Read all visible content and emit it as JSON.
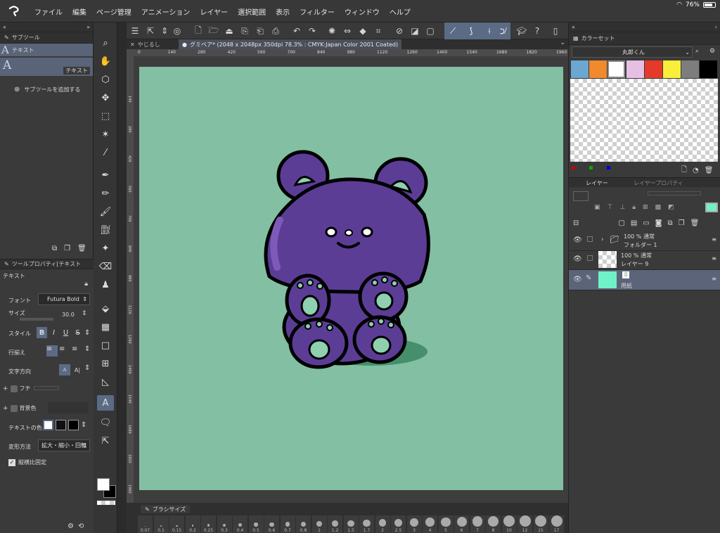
{
  "status": {
    "battery": "76%"
  },
  "menu": [
    "ファイル",
    "編集",
    "ページ管理",
    "アニメーション",
    "レイヤー",
    "選択範囲",
    "表示",
    "フィルター",
    "ウィンドウ",
    "ヘルプ"
  ],
  "subtool": {
    "title": "サブツール",
    "group_label": "テキスト",
    "item_label": "テキスト",
    "add_label": "サブツールを追加する"
  },
  "toolprop": {
    "title": "ツールプロパティ[テキスト",
    "heading": "テキスト",
    "font_label": "フォント",
    "font_value": "Futura Bold",
    "size_label": "サイズ",
    "size_value": "30.0",
    "style_label": "スタイル",
    "align_label": "行揃え",
    "direction_label": "文字方向",
    "edge_label": "フチ",
    "bg_label": "背景色",
    "textcolor_label": "テキストの色",
    "transform_label": "変形方法",
    "transform_value": "拡大・縮小・回転",
    "ratio_label": "縦横比固定"
  },
  "tabs": [
    {
      "label": "やじるし",
      "active": false
    },
    {
      "label": "グミベア* (2048 x 2048px 350dpi 78.3% : CMYK:Japan Color 2001 Coated)",
      "active": true
    }
  ],
  "ruler_ticks": [
    "0",
    "140",
    "280",
    "420",
    "560",
    "700",
    "840",
    "980",
    "1120",
    "1260",
    "1400",
    "1540",
    "1680",
    "1820",
    "1960"
  ],
  "ruler_left_ticks": [
    "140",
    "280",
    "420",
    "560",
    "700",
    "840",
    "980",
    "1120",
    "1260",
    "1400",
    "1540",
    "1680",
    "1820",
    "1960"
  ],
  "brush": {
    "title": "ブラシサイズ",
    "sizes": [
      "0.07",
      "0.1",
      "0.15",
      "0.2",
      "0.25",
      "0.3",
      "0.4",
      "0.5",
      "0.6",
      "0.7",
      "0.8",
      "1",
      "1.2",
      "1.5",
      "1.7",
      "2",
      "2.5",
      "3",
      "4",
      "5",
      "6",
      "7",
      "8",
      "10",
      "12",
      "15",
      "17"
    ]
  },
  "colorset": {
    "title": "カラーセット",
    "set_name": "丸郎くん",
    "swatches": [
      "#6aa8d2",
      "#f08a2c",
      "#ffffff",
      "#e5c0e4",
      "#e53a2a",
      "#f7ef3a",
      "#7d7d7d",
      "#000000"
    ]
  },
  "layers_panel": {
    "tab_layer": "レイヤー",
    "tab_prop": "レイヤープロパティ",
    "rows": [
      {
        "mode": "100 % 通常",
        "name": "フォルダー 1",
        "type": "folder"
      },
      {
        "mode": "100 % 通常",
        "name": "レイヤー 9",
        "type": "raster"
      },
      {
        "mode": "",
        "name": "用紙",
        "type": "paper"
      }
    ]
  },
  "colors": {
    "canvas_bg": "#82bfa3",
    "bear": "#5b3d96",
    "paper": "#6ff2c8",
    "accent": "#5b6b86"
  }
}
